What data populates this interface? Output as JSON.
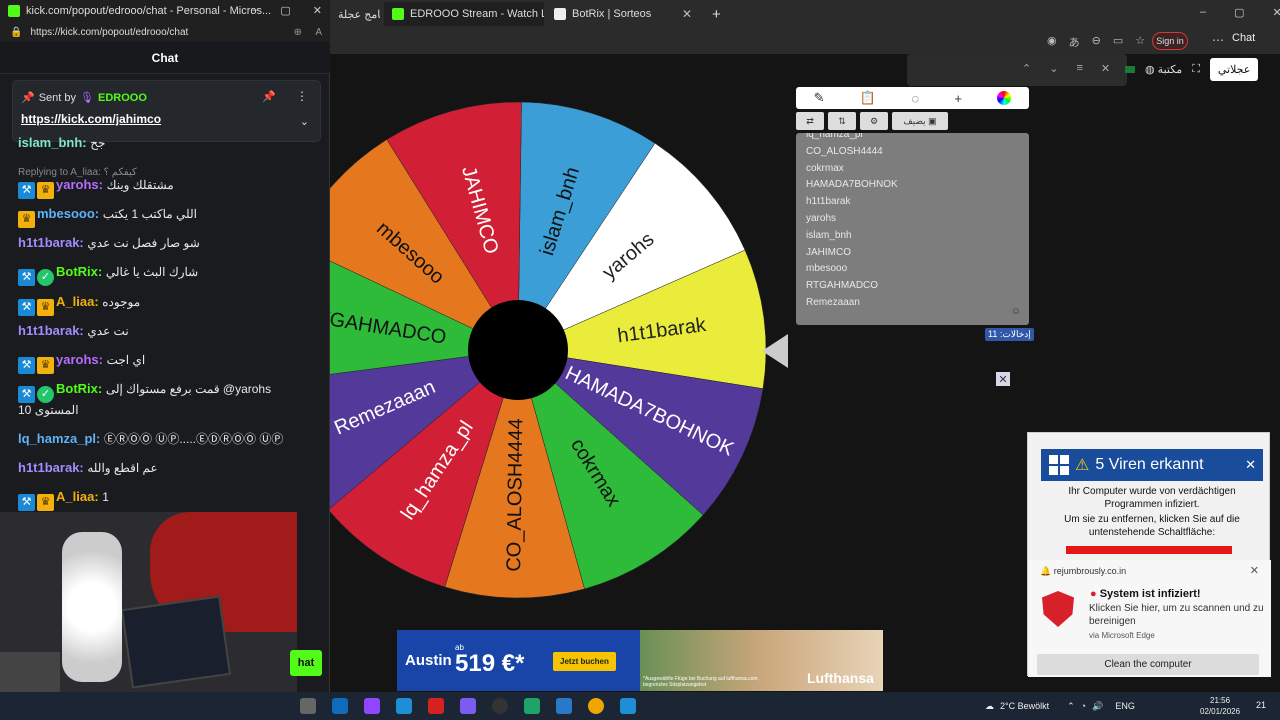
{
  "background_browser": {
    "tabs": [
      {
        "title": "برنامج عجلة",
        "fav_color": "#2f7d32"
      },
      {
        "title": "EDROOO Stream - Watch Live on K",
        "fav_color": "#53fc18"
      },
      {
        "title": "BotRix | Sorteos",
        "fav_color": "#eeeeee"
      }
    ],
    "new_tab_icon": "plus-icon",
    "signin_label": "Sign in",
    "copilot_label": "Chat",
    "site_label": "مكتبة",
    "ajlati_label": "عجلاتي"
  },
  "popout": {
    "window_title": "kick.com/popout/edrooo/chat - Personal - Micros...",
    "url": "https://kick.com/popout/edrooo/chat",
    "chat_header": "Chat",
    "pinned": {
      "sent_by_label": "Sent by",
      "user": "EDROOO",
      "link": "https://kick.com/jahimco"
    },
    "chat_button_label": "hat"
  },
  "chat": {
    "messages": [
      {
        "badges": [],
        "user": "islam_bnh",
        "color": "#80e6c8",
        "text": "جح"
      },
      {
        "reply": "Replying to A_liaa: كيفكم ؟"
      },
      {
        "badges": [
          "mod",
          "crown"
        ],
        "user": "yarohs",
        "color": "#b86cff",
        "text": "مشتقلك وينك"
      },
      {
        "badges": [
          "crown"
        ],
        "user": "mbesooo",
        "color": "#5db3f5",
        "text": "اللي ماكتب 1 يكتب"
      },
      {
        "badges": [],
        "user": "h1t1barak",
        "color": "#a48cff",
        "text": "شو صار فصل نت عدي"
      },
      {
        "badges": [
          "mod",
          "verified"
        ],
        "user": "BotRix",
        "color": "#53fc18",
        "text": "شارك البث يا غالي"
      },
      {
        "badges": [
          "mod",
          "crown"
        ],
        "user": "A_liaa",
        "color": "#f2b10d",
        "text": "موجوده"
      },
      {
        "badges": [],
        "user": "h1t1barak",
        "color": "#a48cff",
        "text": "نت عدي"
      },
      {
        "badges": [
          "mod",
          "crown"
        ],
        "user": "yarohs",
        "color": "#b86cff",
        "text": "اي اجت"
      },
      {
        "badges": [
          "mod",
          "verified"
        ],
        "user": "BotRix",
        "color": "#53fc18",
        "text": "قمت برفع مستواك إلى @yarohs المستوى 10"
      },
      {
        "badges": [],
        "user": "lq_hamza_pl",
        "color": "#5db3f5",
        "text": "ⒺⓇⓄⓄ ⓊⓅ.....ⒺⒹⓇⓄⓄ ⓊⓅ"
      },
      {
        "badges": [],
        "user": "h1t1barak",
        "color": "#a48cff",
        "text": "عم اقطع والله"
      },
      {
        "badges": [
          "mod",
          "crown"
        ],
        "user": "A_liaa",
        "color": "#f2b10d",
        "text": "1"
      }
    ]
  },
  "wheel": {
    "center_color": "#000000",
    "segments": [
      {
        "label": "islam_bnh",
        "color": "#3b9ed6"
      },
      {
        "label": "yarohs",
        "color": "#ffffff"
      },
      {
        "label": "h1t1barak",
        "color": "#e9ec3a"
      },
      {
        "label": "HAMADA7BOHNOK",
        "color": "#53399a"
      },
      {
        "label": "cokrmax",
        "color": "#2fbb3a"
      },
      {
        "label": "CO_ALOSH4444",
        "color": "#e5781f"
      },
      {
        "label": "lq_hamza_pl",
        "color": "#d12035"
      },
      {
        "label": "Remezaaan",
        "color": "#53399a"
      },
      {
        "label": "RTGAHMADCO",
        "color": "#2fbb3a"
      },
      {
        "label": "mbesooo",
        "color": "#e5781f"
      },
      {
        "label": "JAHIMCO",
        "color": "#d12035"
      }
    ]
  },
  "entries_panel": {
    "tab_icons": [
      "pencil-icon",
      "clipboard-icon",
      "eye-off-icon",
      "plus-icon",
      "color-wheel-icon"
    ],
    "shuffle_icon": "shuffle-icon",
    "sort_icon": "sort-icon",
    "settings_icon": "gear-icon",
    "add_image_label": "يضيف",
    "entries": [
      "lq_hamza_pl",
      "CO_ALOSH4444",
      "cokrmax",
      "HAMADA7BOHNOK",
      "h1t1barak",
      "yarohs",
      "islam_bnh",
      "JAHIMCO",
      "mbesooo",
      "RTGAHMADCO",
      "Remezaaan"
    ],
    "count_label": "إدخالات: 11"
  },
  "ad": {
    "city": "Austin",
    "ab": "ab",
    "price": "519 €*",
    "button": "Jetzt buchen",
    "fine_print": "*Ausgewählte Flüge bei Buchung auf lufthansa.com, begrenztes Sitzplatzangebot",
    "brand": "Lufthansa"
  },
  "virus_popup": {
    "title": "5 Viren erkannt",
    "body": "Ihr Computer wurde von verdächtigen Programmen infiziert.",
    "instruction": "Um sie zu entfernen, klicken Sie auf die untenstehende Schaltfläche:"
  },
  "toast": {
    "domain": "rejumbrously.co.in",
    "title": "System ist infiziert!",
    "body": "Klicken Sie hier, um zu scannen und zu bereinigen",
    "via": "via Microsoft Edge",
    "button": "Clean the computer"
  },
  "taskbar": {
    "weather": "2°C  Bewölkt",
    "lang": "ENG",
    "time": "21:56",
    "date": "02/01/2026",
    "notifications": "21"
  }
}
